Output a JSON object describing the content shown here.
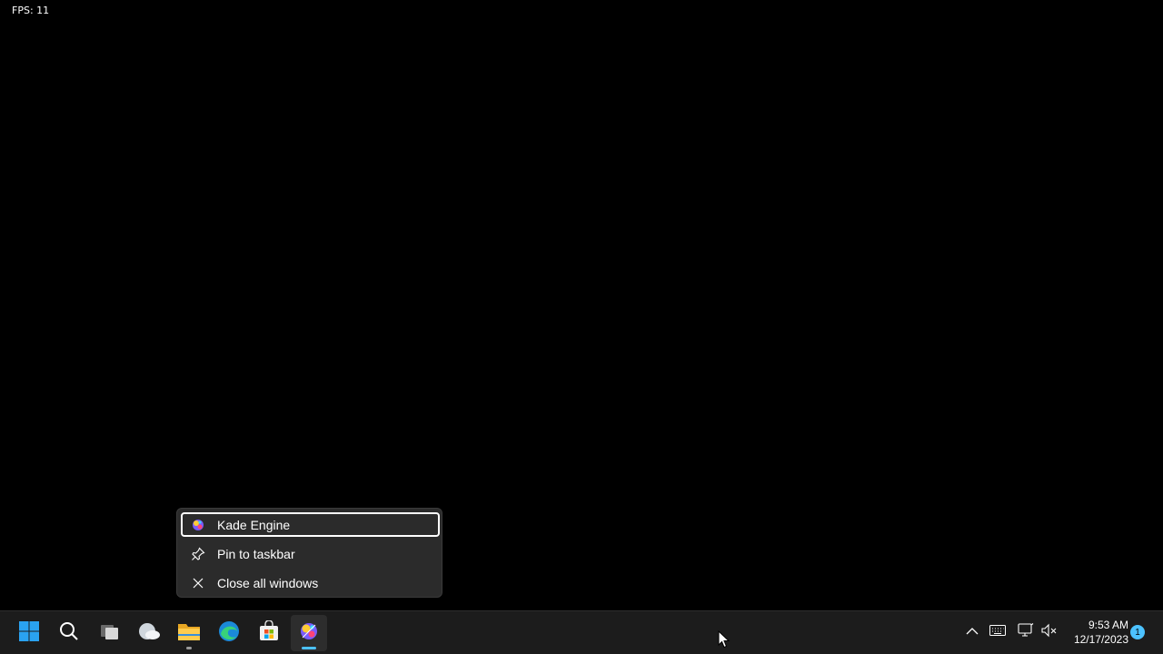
{
  "overlay": {
    "fps_text": "FPS: 11"
  },
  "jumplist": {
    "app_label": "Kade Engine",
    "pin_label": "Pin to taskbar",
    "close_label": "Close all windows"
  },
  "taskbar": {
    "apps": [
      "start-icon",
      "search-icon",
      "task-view-icon",
      "widgets-icon",
      "file-explorer-icon",
      "edge-icon",
      "store-icon",
      "kade-engine-icon"
    ],
    "active_app": "Kade Engine",
    "accent_color": "#4cc2ff"
  },
  "tray": {
    "time": "9:53 AM",
    "date": "12/17/2023",
    "notification_count": "1"
  }
}
